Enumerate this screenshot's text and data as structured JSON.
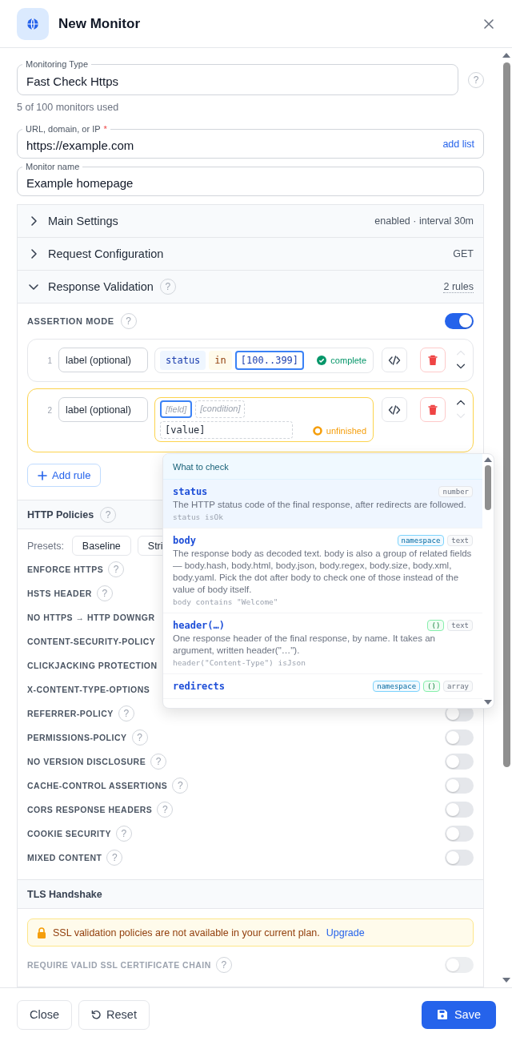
{
  "dialog": {
    "title": "New Monitor"
  },
  "monitoring_type": {
    "label": "Monitoring Type",
    "value": "Fast Check Https",
    "help": "?"
  },
  "usage_note": "5 of 100 monitors used",
  "url_field": {
    "label": "URL, domain, or IP",
    "required_mark": "*",
    "value": "https://example.com",
    "action": "add list"
  },
  "name_field": {
    "label": "Monitor name",
    "value": "Example homepage"
  },
  "sections": [
    {
      "title": "Main Settings",
      "expanded": false,
      "summary": "enabled · interval 30m"
    },
    {
      "title": "Request Configuration",
      "expanded": false,
      "summary": "GET"
    },
    {
      "title": "Response Validation",
      "expanded": true,
      "help": "?",
      "summary": "2 rules"
    }
  ],
  "assertions": {
    "mode_label": "ASSERTION MODE",
    "help": "?",
    "on": true,
    "rules": [
      {
        "number": "1",
        "label_placeholder": "label (optional)",
        "status_kind": "complete",
        "up_disabled": true,
        "down_disabled": false,
        "tokens": [
          {
            "kind": "field",
            "text": "status",
            "focused": false
          },
          {
            "kind": "operator",
            "text": "in",
            "focused": false
          },
          {
            "kind": "value",
            "text": "[100..399]",
            "focused": true
          }
        ]
      },
      {
        "number": "2",
        "label_placeholder": "label (optional)",
        "status_kind": "unfinished",
        "up_disabled": false,
        "down_disabled": true,
        "tokens": [
          {
            "kind": "placeholder",
            "text": "[field]",
            "focused": true
          },
          {
            "kind": "placeholder",
            "text": "[condition]",
            "focused": false
          },
          {
            "kind": "value_placeholder",
            "text": "[value]",
            "focused": false
          }
        ]
      }
    ],
    "add_rule": "Add rule"
  },
  "http_policies": {
    "title": "HTTP Policies",
    "help": "?",
    "presets_label": "Presets:",
    "presets": [
      "Baseline",
      "Stri"
    ],
    "rows": [
      {
        "label": "ENFORCE HTTPS",
        "help": "?"
      },
      {
        "label": "HSTS HEADER",
        "help": "?"
      },
      {
        "label": "NO HTTPS → HTTP DOWNGR"
      },
      {
        "label": "CONTENT-SECURITY-POLICY"
      },
      {
        "label": "CLICKJACKING PROTECTION"
      },
      {
        "label": "X-CONTENT-TYPE-OPTIONS"
      },
      {
        "label": "REFERRER-POLICY",
        "help": "?",
        "on": false
      },
      {
        "label": "PERMISSIONS-POLICY",
        "help": "?",
        "on": false
      },
      {
        "label": "NO VERSION DISCLOSURE",
        "help": "?",
        "on": false
      },
      {
        "label": "CACHE-CONTROL ASSERTIONS",
        "help": "?",
        "on": false
      },
      {
        "label": "CORS RESPONSE HEADERS",
        "help": "?",
        "on": false
      },
      {
        "label": "COOKIE SECURITY",
        "help": "?",
        "on": false
      },
      {
        "label": "MIXED CONTENT",
        "help": "?",
        "on": false
      }
    ]
  },
  "tls": {
    "title": "TLS Handshake",
    "notice": {
      "text": "SSL validation policies are not available in your current plan.",
      "link": "Upgrade"
    },
    "rows": [
      {
        "label": "REQUIRE VALID SSL CERTIFICATE CHAIN",
        "help": "?",
        "on": false,
        "disabled": true
      }
    ]
  },
  "field_menu": {
    "title": "What to check",
    "options": [
      {
        "name": "status",
        "selected": true,
        "tags": [
          {
            "kind": "type",
            "text": "number"
          }
        ],
        "description": "The HTTP status code of the final response, after redirects are followed.",
        "example": "status isOk"
      },
      {
        "name": "body",
        "selected": false,
        "tags": [
          {
            "kind": "namespace",
            "text": "namespace"
          },
          {
            "kind": "type",
            "text": "text"
          }
        ],
        "description": "The response body as decoded text. body is also a group of related fields — body.hash, body.html, body.json, body.regex, body.size, body.xml, body.yaml. Pick the dot after body to check one of those instead of the value of body itself.",
        "example": "body contains \"Welcome\""
      },
      {
        "name": "header(…)",
        "selected": false,
        "tags": [
          {
            "kind": "call",
            "text": "()"
          },
          {
            "kind": "type",
            "text": "text"
          }
        ],
        "description": "One response header of the final response, by name. It takes an argument, written header(\"…\").",
        "example": "header(\"Content-Type\") isJson"
      },
      {
        "name": "redirects",
        "selected": false,
        "tags": [
          {
            "kind": "namespace",
            "text": "namespace"
          },
          {
            "kind": "call",
            "text": "()"
          },
          {
            "kind": "type",
            "text": "array"
          }
        ]
      }
    ]
  },
  "footer": {
    "close": "Close",
    "reset": "Reset",
    "save": "Save"
  }
}
